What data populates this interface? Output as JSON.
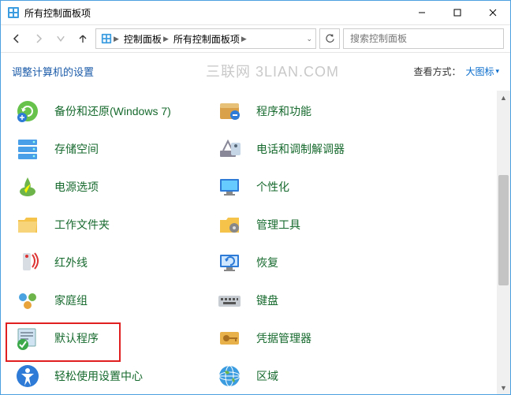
{
  "window": {
    "title": "所有控制面板项"
  },
  "breadcrumb": {
    "seg1": "控制面板",
    "seg2": "所有控制面板项"
  },
  "search": {
    "placeholder": "搜索控制面板"
  },
  "header": {
    "leftLabel": "调整计算机的设置",
    "viewByLabel": "查看方式：",
    "viewValue": "大图标"
  },
  "watermark": "三联网 3LIAN.COM",
  "items": [
    {
      "id": "backup",
      "label": "备份和还原(Windows 7)"
    },
    {
      "id": "programs",
      "label": "程序和功能"
    },
    {
      "id": "storage",
      "label": "存储空间"
    },
    {
      "id": "modem",
      "label": "电话和调制解调器"
    },
    {
      "id": "power",
      "label": "电源选项"
    },
    {
      "id": "personalize",
      "label": "个性化"
    },
    {
      "id": "workfolders",
      "label": "工作文件夹"
    },
    {
      "id": "admintools",
      "label": "管理工具"
    },
    {
      "id": "infrared",
      "label": "红外线"
    },
    {
      "id": "recovery",
      "label": "恢复"
    },
    {
      "id": "homegroup",
      "label": "家庭组"
    },
    {
      "id": "keyboard",
      "label": "键盘"
    },
    {
      "id": "defaults",
      "label": "默认程序"
    },
    {
      "id": "credentials",
      "label": "凭据管理器"
    },
    {
      "id": "ease",
      "label": "轻松使用设置中心"
    },
    {
      "id": "region",
      "label": "区域"
    }
  ],
  "highlightedItem": "defaults"
}
